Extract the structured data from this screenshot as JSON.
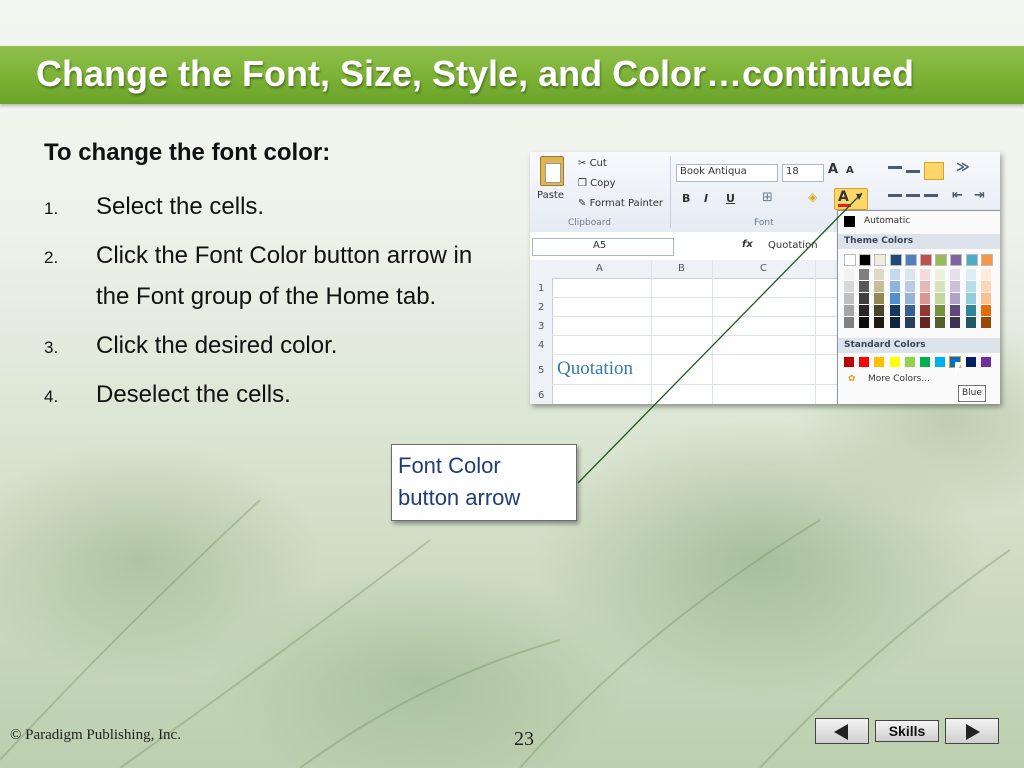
{
  "slide": {
    "title": "Change the Font, Size, Style, and Color…continued",
    "heading": "To change the font color:",
    "steps": [
      {
        "num": "1.",
        "text": "Select the cells."
      },
      {
        "num": "2.",
        "text": "Click the Font Color button arrow in the Font group of the Home tab."
      },
      {
        "num": "3.",
        "text": "Click the desired color."
      },
      {
        "num": "4.",
        "text": "Deselect the cells."
      }
    ],
    "callout": {
      "line1": "Font Color",
      "line2": "button arrow"
    },
    "footer": "© Paradigm Publishing, Inc.",
    "page_number": "23",
    "nav": {
      "skills_label": "Skills",
      "prev_icon": "left-triangle-icon",
      "next_icon": "right-triangle-icon"
    }
  },
  "screenshot": {
    "clipboard": {
      "paste_label": "Paste",
      "cut_label": "Cut",
      "copy_label": "Copy",
      "format_painter_label": "Format Painter",
      "group_label": "Clipboard"
    },
    "font": {
      "font_name": "Book Antiqua",
      "font_size": "18",
      "group_label": "Font",
      "bold": "B",
      "italic": "I",
      "underline": "U",
      "grow": "A",
      "shrink": "A",
      "font_color_glyph": "A"
    },
    "formula_bar": {
      "name_box": "A5",
      "fx": "fx",
      "content": "Quotation"
    },
    "columns": [
      "A",
      "B",
      "C"
    ],
    "rows": [
      "1",
      "2",
      "3",
      "4",
      "5",
      "6"
    ],
    "cell_text": "Quotation",
    "dropdown": {
      "automatic_label": "Automatic",
      "theme_colors_label": "Theme Colors",
      "standard_colors_label": "Standard Colors",
      "more_colors_label": "More Colors...",
      "tooltip": "Blue",
      "theme_top": [
        "#ffffff",
        "#000000",
        "#eeece1",
        "#1f497d",
        "#4f81bd",
        "#c0504d",
        "#9bbb59",
        "#8064a2",
        "#4bacc6",
        "#f79646"
      ],
      "theme_cols": [
        [
          "#f2f2f2",
          "#d8d8d8",
          "#bfbfbf",
          "#a5a5a5",
          "#7f7f7f"
        ],
        [
          "#7f7f7f",
          "#595959",
          "#3f3f3f",
          "#262626",
          "#0c0c0c"
        ],
        [
          "#ddd9c3",
          "#c4bd97",
          "#938953",
          "#494429",
          "#1d1b10"
        ],
        [
          "#c6d9f0",
          "#8db3e2",
          "#548dd4",
          "#17365d",
          "#0f243e"
        ],
        [
          "#dbe5f1",
          "#b8cce4",
          "#95b3d7",
          "#366092",
          "#244061"
        ],
        [
          "#f2dcdb",
          "#e5b9b7",
          "#d99694",
          "#953734",
          "#632423"
        ],
        [
          "#ebf1dd",
          "#d7e3bc",
          "#c3d69b",
          "#76923c",
          "#4f6128"
        ],
        [
          "#e5e0ec",
          "#ccc1d9",
          "#b2a2c7",
          "#5f497a",
          "#3f3151"
        ],
        [
          "#dbeef3",
          "#b7dde8",
          "#92cddc",
          "#31859b",
          "#205867"
        ],
        [
          "#fdeada",
          "#fbd5b5",
          "#fac08f",
          "#e36c09",
          "#974806"
        ]
      ],
      "standard": [
        "#c00000",
        "#ff0000",
        "#ffc000",
        "#ffff00",
        "#92d050",
        "#00b050",
        "#00b0f0",
        "#0070c0",
        "#002060",
        "#7030a0"
      ]
    }
  }
}
